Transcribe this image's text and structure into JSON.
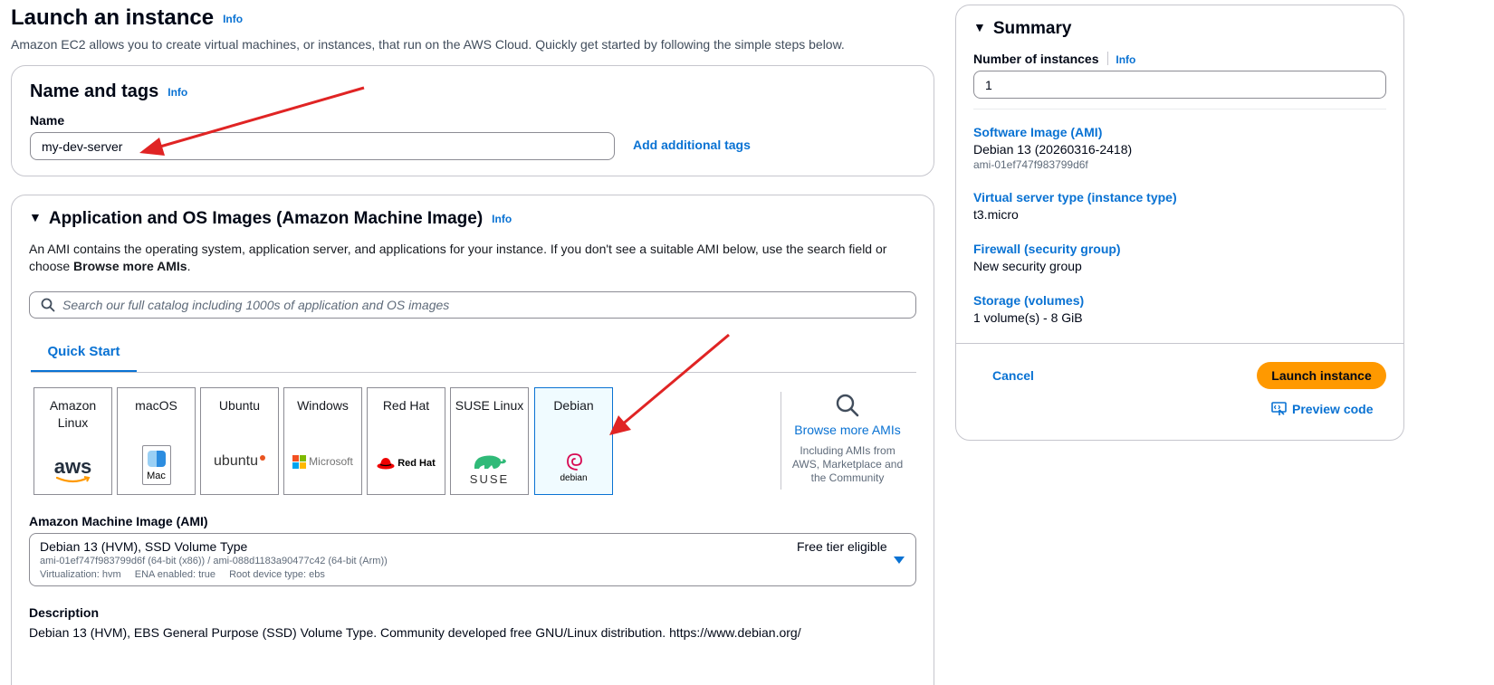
{
  "header": {
    "title": "Launch an instance",
    "info": "Info",
    "subtitle": "Amazon EC2 allows you to create virtual machines, or instances, that run on the AWS Cloud. Quickly get started by following the simple steps below."
  },
  "name_tags": {
    "title": "Name and tags",
    "info": "Info",
    "name_label": "Name",
    "name_value": "my-dev-server",
    "add_tags": "Add additional tags"
  },
  "ami_section": {
    "title": "Application and OS Images (Amazon Machine Image)",
    "info": "Info",
    "desc_line1": "An AMI contains the operating system, application server, and applications for your instance. If you don't see a suitable AMI below, use the search field or choose",
    "desc_bold": "Browse more AMIs",
    "desc_end": ".",
    "search_placeholder": "Search our full catalog including 1000s of application and OS images",
    "tab": "Quick Start",
    "tiles": [
      {
        "name": "Amazon Linux",
        "logo": "aws"
      },
      {
        "name": "macOS",
        "logo": "Mac"
      },
      {
        "name": "Ubuntu",
        "logo": "ubuntu"
      },
      {
        "name": "Windows",
        "logo": "Microsoft"
      },
      {
        "name": "Red Hat",
        "logo": "Red Hat"
      },
      {
        "name": "SUSE Linux",
        "logo": "SUSE"
      },
      {
        "name": "Debian",
        "logo": "debian"
      }
    ],
    "browse_more": "Browse more AMIs",
    "browse_desc": "Including AMIs from AWS, Marketplace and the Community",
    "ami_label": "Amazon Machine Image (AMI)",
    "ami_name": "Debian 13 (HVM), SSD Volume Type",
    "ami_ids": "ami-01ef747f983799d6f (64-bit (x86)) / ami-088d1183a90477c42 (64-bit (Arm))",
    "ami_virt": "Virtualization: hvm",
    "ami_ena": "ENA enabled: true",
    "ami_root": "Root device type: ebs",
    "free_tier": "Free tier eligible",
    "description_label": "Description",
    "description_text": "Debian 13 (HVM), EBS General Purpose (SSD) Volume Type. Community developed free GNU/Linux distribution. https://www.debian.org/"
  },
  "summary": {
    "title": "Summary",
    "num_label": "Number of instances",
    "info": "Info",
    "num_value": "1",
    "software_label": "Software Image (AMI)",
    "software_value": "Debian 13 (20260316-2418)",
    "software_id": "ami-01ef747f983799d6f",
    "instance_label": "Virtual server type (instance type)",
    "instance_value": "t3.micro",
    "firewall_label": "Firewall (security group)",
    "firewall_value": "New security group",
    "storage_label": "Storage (volumes)",
    "storage_value": "1 volume(s) - 8 GiB",
    "cancel": "Cancel",
    "launch": "Launch instance",
    "preview": "Preview code"
  },
  "colors": {
    "accent": "#0972d3",
    "launch": "#ff9900",
    "annotation_arrow": "#e02424"
  }
}
